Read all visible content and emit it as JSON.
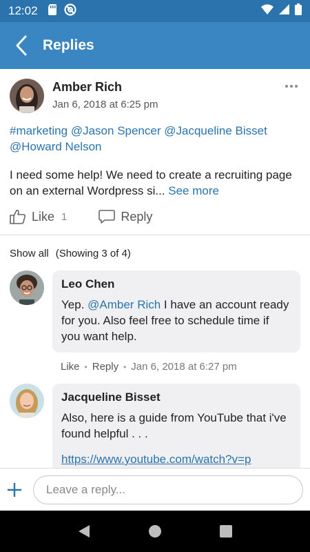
{
  "status_bar": {
    "time": "12:02"
  },
  "app_bar": {
    "title": "Replies"
  },
  "post": {
    "author": "Amber Rich",
    "date": "Jan 6, 2018 at 6:25 pm",
    "tags": [
      "#marketing",
      "@Jason Spencer",
      "@Jacqueline Bisset",
      "@Howard Nelson"
    ],
    "body": "I need some help! We need to create a recruiting page on an external Wordpress si...",
    "see_more": "See more",
    "like_label": "Like",
    "like_count": "1",
    "reply_label": "Reply"
  },
  "replies_header": {
    "show_all": "Show all",
    "showing": "(Showing 3 of 4)"
  },
  "replies": [
    {
      "author": "Leo Chen",
      "text_prefix": "Yep. ",
      "mention": "@Amber Rich",
      "text_suffix": " I have an account ready for you.  Also feel free to schedule time if you want help.",
      "like_label": "Like",
      "reply_label": "Reply",
      "date": "Jan 6, 2018 at 6:27 pm"
    },
    {
      "author": "Jacqueline Bisset",
      "text": "Also, here is a guide from YouTube that i've found helpful . . .",
      "link": "https://www.youtube.com/watch?v=p"
    }
  ],
  "composer": {
    "placeholder": "Leave a reply..."
  },
  "colors": {
    "app_bar": "#3a86c2",
    "status_bar": "#2a73ad",
    "link": "#2a73ad",
    "bubble": "#f0f0f3"
  }
}
